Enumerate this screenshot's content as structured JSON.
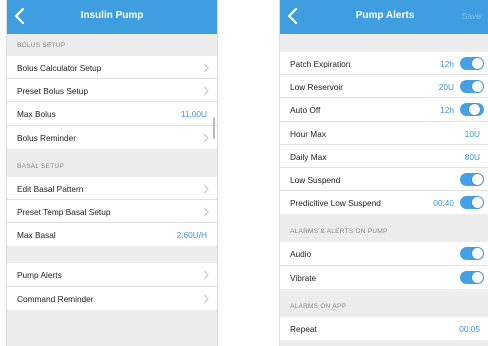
{
  "colors": {
    "accent": "#3e9ee0",
    "value_blue": "#3f95d4",
    "value_gray": "#9b9b9b",
    "toggle_on": "#45a1e6",
    "toggle_off": "#e0e0e0"
  },
  "insulin_pump": {
    "title": "Insulin Pump",
    "bolus_header": "BOLUS SETUP",
    "bolus_items": [
      {
        "label": "Bolus Calculator Setup"
      },
      {
        "label": "Preset Bolus Setup"
      },
      {
        "label": "Max Bolus",
        "value": "11.00U"
      },
      {
        "label": "Bolus Reminder"
      }
    ],
    "basal_header": "BASAL SETUP",
    "basal_items": [
      {
        "label": "Edit Basal Pattern"
      },
      {
        "label": "Preset Temp Basal Setup"
      },
      {
        "label": "Max Basal",
        "value": "2.60U/H"
      }
    ],
    "other_items": [
      {
        "label": "Pump Alerts"
      },
      {
        "label": "Command Reminder"
      }
    ]
  },
  "pump_alerts": {
    "title": "Pump Alerts",
    "save_label": "Save",
    "items": [
      {
        "label": "Patch Expiration",
        "value": "12h",
        "toggle": "on"
      },
      {
        "label": "Low Reservoir",
        "value": "20U",
        "toggle": "on"
      },
      {
        "label": "Auto Off",
        "value": "12h",
        "toggle": "off"
      },
      {
        "label": "Hour Max",
        "value": "10U"
      },
      {
        "label": "Daily Max",
        "value": "80U"
      },
      {
        "label": "Low Suspend",
        "toggle": "on"
      },
      {
        "label": "Predicitive Low Suspend",
        "value": "00:40",
        "toggle": "on"
      }
    ],
    "pump_header": "ALARMS & ALERTS ON PUMP",
    "pump_items": [
      {
        "label": "Audio",
        "toggle": "on"
      },
      {
        "label": "Vibrate",
        "toggle": "on"
      }
    ],
    "app_header": "ALARMS ON APP",
    "app_items": [
      {
        "label": "Repeat",
        "value": "00:05"
      }
    ]
  }
}
